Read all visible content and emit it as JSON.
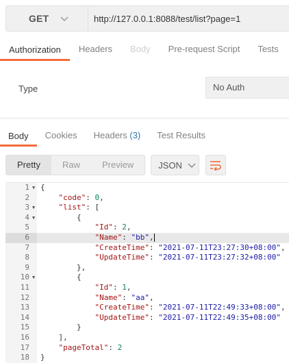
{
  "request": {
    "method": "GET",
    "url": "http://127.0.0.1:8088/test/list?page=1"
  },
  "request_tabs": [
    {
      "label": "Authorization",
      "state": "active"
    },
    {
      "label": "Headers",
      "state": "normal"
    },
    {
      "label": "Body",
      "state": "disabled"
    },
    {
      "label": "Pre-request Script",
      "state": "normal"
    },
    {
      "label": "Tests",
      "state": "normal"
    }
  ],
  "auth": {
    "type_label": "Type",
    "type_value": "No Auth"
  },
  "response_tabs": [
    {
      "label": "Body",
      "count": "",
      "state": "active"
    },
    {
      "label": "Cookies",
      "count": "",
      "state": "normal"
    },
    {
      "label": "Headers",
      "count": "(3)",
      "state": "normal"
    },
    {
      "label": "Test Results",
      "count": "",
      "state": "normal"
    }
  ],
  "view_modes": [
    {
      "label": "Pretty",
      "active": true
    },
    {
      "label": "Raw",
      "active": false
    },
    {
      "label": "Preview",
      "active": false
    }
  ],
  "format": "JSON",
  "icons": {
    "method_dropdown": "chevron-down-icon",
    "format_dropdown": "chevron-down-icon",
    "wrap": "wrap-lines-icon",
    "fold": "fold-arrow-icon"
  },
  "colors": {
    "accent": "#f26b3a",
    "count": "#2a7ab0",
    "json_key": "#a31515",
    "json_string": "#1a1aa6",
    "json_number": "#098658"
  },
  "code_lines": [
    {
      "n": "1",
      "fold": true,
      "text": "{"
    },
    {
      "n": "2",
      "fold": false,
      "text": "    \"code\": 0,"
    },
    {
      "n": "3",
      "fold": true,
      "text": "    \"list\": ["
    },
    {
      "n": "4",
      "fold": true,
      "text": "        {"
    },
    {
      "n": "5",
      "fold": false,
      "text": "            \"Id\": 2,"
    },
    {
      "n": "6",
      "fold": false,
      "text": "            \"Name\": \"bb\",",
      "highlight": true
    },
    {
      "n": "7",
      "fold": false,
      "text": "            \"CreateTime\": \"2021-07-11T23:27:30+08:00\","
    },
    {
      "n": "8",
      "fold": false,
      "text": "            \"UpdateTime\": \"2021-07-11T23:27:32+08:00\""
    },
    {
      "n": "9",
      "fold": false,
      "text": "        },"
    },
    {
      "n": "10",
      "fold": true,
      "text": "        {"
    },
    {
      "n": "11",
      "fold": false,
      "text": "            \"Id\": 1,"
    },
    {
      "n": "12",
      "fold": false,
      "text": "            \"Name\": \"aa\","
    },
    {
      "n": "13",
      "fold": false,
      "text": "            \"CreateTime\": \"2021-07-11T22:49:33+08:00\","
    },
    {
      "n": "14",
      "fold": false,
      "text": "            \"UpdateTime\": \"2021-07-11T22:49:35+08:00\""
    },
    {
      "n": "15",
      "fold": false,
      "text": "        }"
    },
    {
      "n": "16",
      "fold": false,
      "text": "    ],"
    },
    {
      "n": "17",
      "fold": false,
      "text": "    \"pageTotal\": 2"
    },
    {
      "n": "18",
      "fold": false,
      "text": "}"
    }
  ]
}
